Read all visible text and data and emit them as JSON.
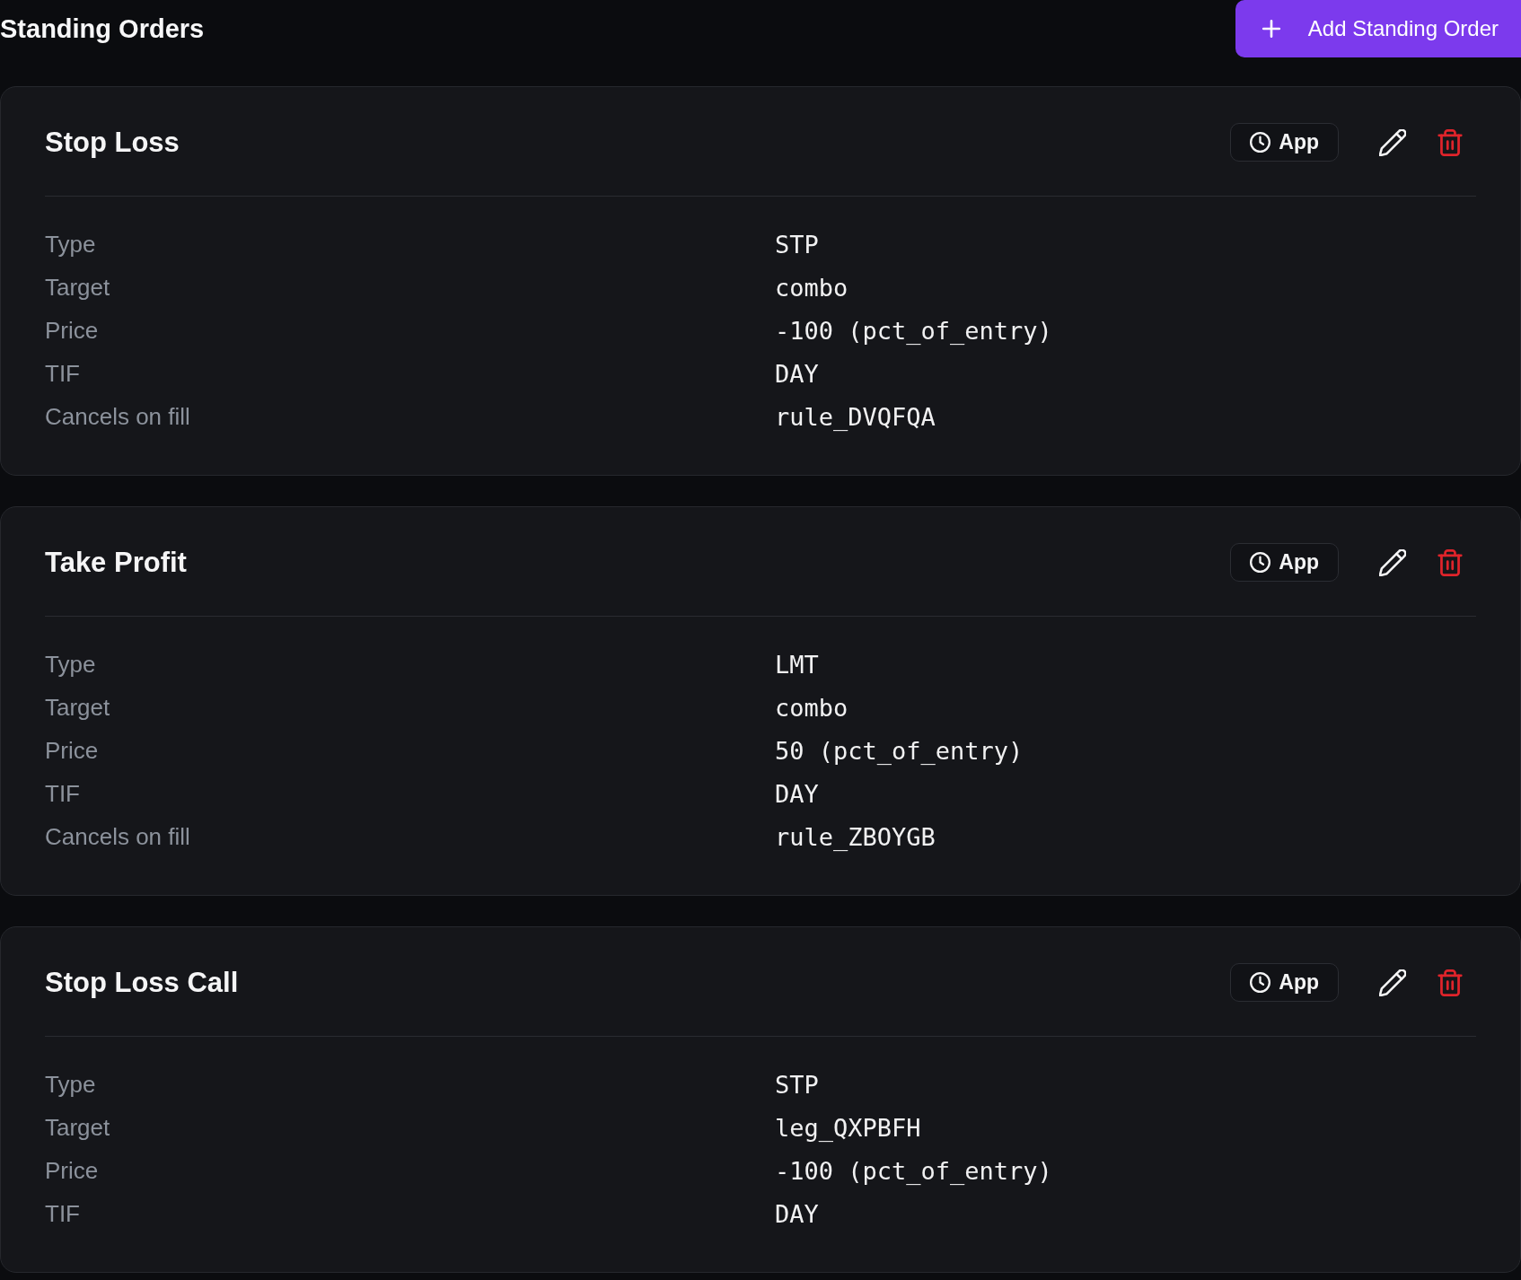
{
  "page_title": "Standing Orders",
  "add_button": {
    "label": "Add Standing Order"
  },
  "orders": [
    {
      "name": "Stop Loss",
      "badge": "App",
      "fields": [
        {
          "label": "Type",
          "value": "STP"
        },
        {
          "label": "Target",
          "value": "combo"
        },
        {
          "label": "Price",
          "value": "-100 (pct_of_entry)"
        },
        {
          "label": "TIF",
          "value": "DAY"
        },
        {
          "label": "Cancels on fill",
          "value": "rule_DVQFQA"
        }
      ]
    },
    {
      "name": "Take Profit",
      "badge": "App",
      "fields": [
        {
          "label": "Type",
          "value": "LMT"
        },
        {
          "label": "Target",
          "value": "combo"
        },
        {
          "label": "Price",
          "value": "50 (pct_of_entry)"
        },
        {
          "label": "TIF",
          "value": "DAY"
        },
        {
          "label": "Cancels on fill",
          "value": "rule_ZBOYGB"
        }
      ]
    },
    {
      "name": "Stop Loss Call",
      "badge": "App",
      "fields": [
        {
          "label": "Type",
          "value": "STP"
        },
        {
          "label": "Target",
          "value": "leg_QXPBFH"
        },
        {
          "label": "Price",
          "value": "-100 (pct_of_entry)"
        },
        {
          "label": "TIF",
          "value": "DAY"
        }
      ]
    }
  ]
}
